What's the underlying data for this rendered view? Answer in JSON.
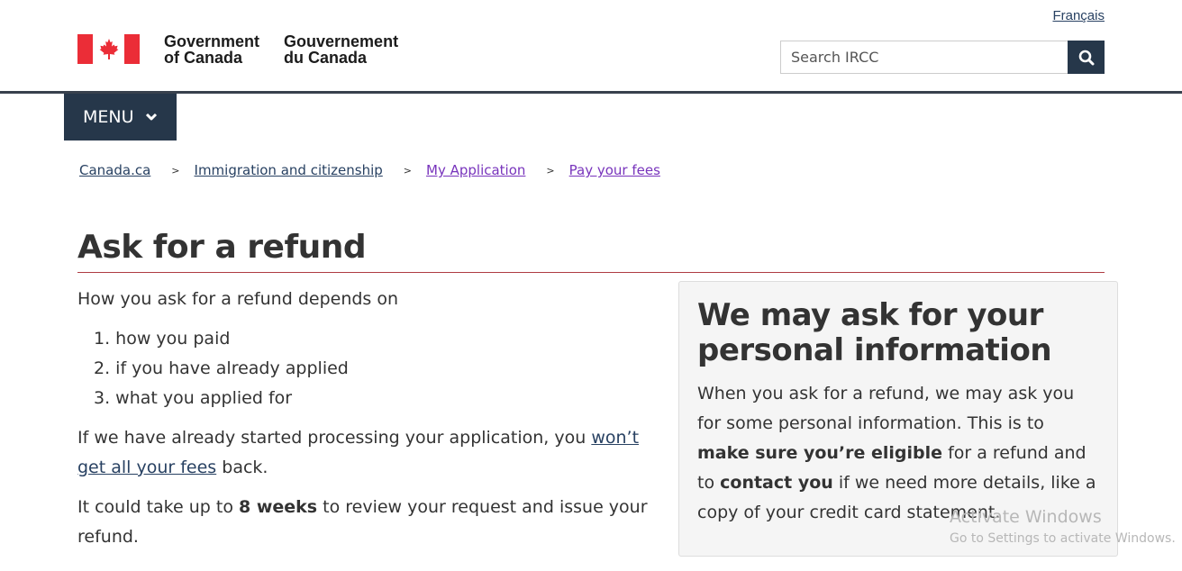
{
  "header": {
    "language_link": "Français",
    "brand_en_line1": "Government",
    "brand_en_line2": "of Canada",
    "brand_fr_line1": "Gouvernement",
    "brand_fr_line2": "du Canada",
    "flag_colors": {
      "red": "#eb2d37",
      "white": "#ffffff"
    },
    "search": {
      "placeholder": "Search IRCC",
      "value": "",
      "button_icon": "search-icon"
    }
  },
  "menu": {
    "label": "MENU",
    "icon": "chevron-down-icon"
  },
  "breadcrumb": {
    "separator": ">",
    "items": [
      {
        "label": "Canada.ca"
      },
      {
        "label": "Immigration and citizenship"
      },
      {
        "label": "My Application"
      },
      {
        "label": "Pay your fees"
      }
    ]
  },
  "page": {
    "title": "Ask for a refund",
    "intro": "How you ask for a refund depends on",
    "list": [
      "1. how you paid",
      "2. if you have already applied",
      "3. what you applied for"
    ],
    "para1_before": "If we have already started processing your application, you ",
    "para1_link": "won’t get all your fees",
    "para1_after": " back.",
    "para2_before": "It could take up to ",
    "para2_bold": "8 weeks",
    "para2_after": " to review your request and issue your refund."
  },
  "aside": {
    "title": "We may ask for your personal information",
    "text_1": "When you ask for a refund, we may ask you for some personal information. This is to ",
    "bold_1": "make sure you’re eligible",
    "text_2": " for a refund and to ",
    "bold_2": "contact you",
    "text_3": " if we need more details, like a copy of your credit card statement."
  },
  "watermark": {
    "title": "Activate Windows",
    "subtitle": "Go to Settings to activate Windows."
  },
  "colors": {
    "header_dark": "#26374a",
    "link": "#284162",
    "visited_link": "#7834bc",
    "title_rule": "#af3c43",
    "panel_bg": "#f5f5f5"
  }
}
